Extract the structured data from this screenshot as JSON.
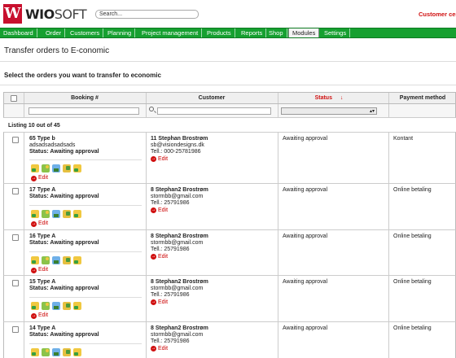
{
  "brand": {
    "logo_letter": "W",
    "name_bold": "WIO",
    "name_light": "SOFT"
  },
  "search": {
    "placeholder": "Search..."
  },
  "customer_link": "Customer cen",
  "nav": [
    {
      "label": "Dashboard"
    },
    {
      "label": "Order"
    },
    {
      "label": "Customers"
    },
    {
      "label": "Planning"
    },
    {
      "label": "Project management"
    },
    {
      "label": "Products"
    },
    {
      "label": "Reports"
    },
    {
      "label": "Shop"
    },
    {
      "label": "Modules",
      "active": true
    },
    {
      "label": "Settings"
    }
  ],
  "page_title": "Transfer orders to E-conomic",
  "section_title": "Select the orders you want to transfer to economic",
  "table": {
    "headers": {
      "booking": "Booking #",
      "customer": "Customer",
      "status": "Status",
      "sort_arrow": "↓",
      "payment": "Payment method"
    },
    "filter_select_arrows": "▴▾",
    "listing": "Listing 10 out of 45",
    "edit_label": "Edit",
    "rows": [
      {
        "booking": "65 Type b",
        "note": "adsadsadsadsads",
        "status_line": "Status: Awaiting approval",
        "customer_name": "11 Stephan Brostrøm",
        "email": "sb@visiondesigns.dk",
        "tel": "Tell.: 000-25781986",
        "status": "Awaiting approval",
        "payment": "Kontant"
      },
      {
        "booking": "17 Type A",
        "note": "",
        "status_line": "Status: Awaiting approval",
        "customer_name": "8 Stephan2 Brostrøm",
        "email": "stormbb@gmail.com",
        "tel": "Tell.: 25791986",
        "status": "Awaiting approval",
        "payment": "Online betaling"
      },
      {
        "booking": "16 Type A",
        "note": "",
        "status_line": "Status: Awaiting approval",
        "customer_name": "8 Stephan2 Brostrøm",
        "email": "stormbb@gmail.com",
        "tel": "Tell.: 25791986",
        "status": "Awaiting approval",
        "payment": "Online betaling"
      },
      {
        "booking": "15 Type A",
        "note": "",
        "status_line": "Status: Awaiting approval",
        "customer_name": "8 Stephan2 Brostrøm",
        "email": "stormbb@gmail.com",
        "tel": "Tell.: 25791986",
        "status": "Awaiting approval",
        "payment": "Online betaling"
      },
      {
        "booking": "14 Type A",
        "note": "",
        "status_line": "Status: Awaiting approval",
        "customer_name": "8 Stephan2 Brostrøm",
        "email": "stormbb@gmail.com",
        "tel": "Tell.: 25791986",
        "status": "Awaiting approval",
        "payment": "Online betaling"
      }
    ]
  },
  "colors": {
    "nav_green": "#16a030",
    "brand_red": "#c8102e",
    "status_red": "#d01010"
  }
}
